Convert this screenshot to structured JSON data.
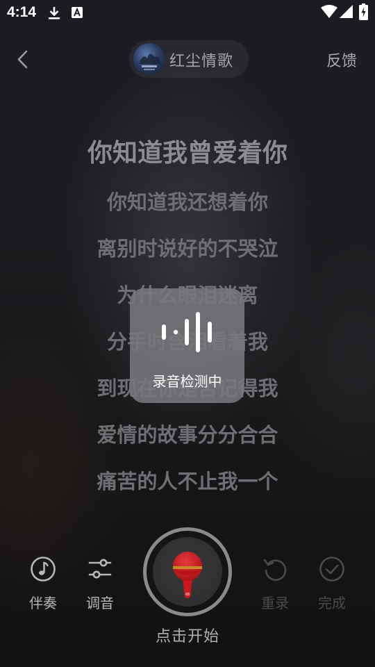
{
  "status_bar": {
    "time": "4:14",
    "icons": [
      "download-icon",
      "font-a-icon",
      "wifi-icon",
      "signal-icon",
      "battery-charging-icon"
    ]
  },
  "header": {
    "back_icon": "chevron-left-icon",
    "song_title": "红尘情歌",
    "feedback_label": "反馈"
  },
  "lyrics": {
    "current": "你知道我曾爱着你",
    "lines": [
      "你知道我还想着你",
      "离别时说好的不哭泣",
      "为什么眼泪迷离",
      "分手时含泪看着我",
      "到现在你是否记得我",
      "爱情的故事分分合合",
      "痛苦的人不止我一个"
    ]
  },
  "overlay": {
    "icon": "audio-wave-icon",
    "text": "录音检测中"
  },
  "controls": {
    "accompaniment_label": "伴奏",
    "tuning_label": "调音",
    "record_label": "点击开始",
    "rerecord_label": "重录",
    "finish_label": "完成"
  },
  "colors": {
    "mic_red": "#c8171c",
    "mic_band": "#c98a2a",
    "active_icon": "#b7b7ba",
    "disabled_icon": "#4a4a4d"
  }
}
